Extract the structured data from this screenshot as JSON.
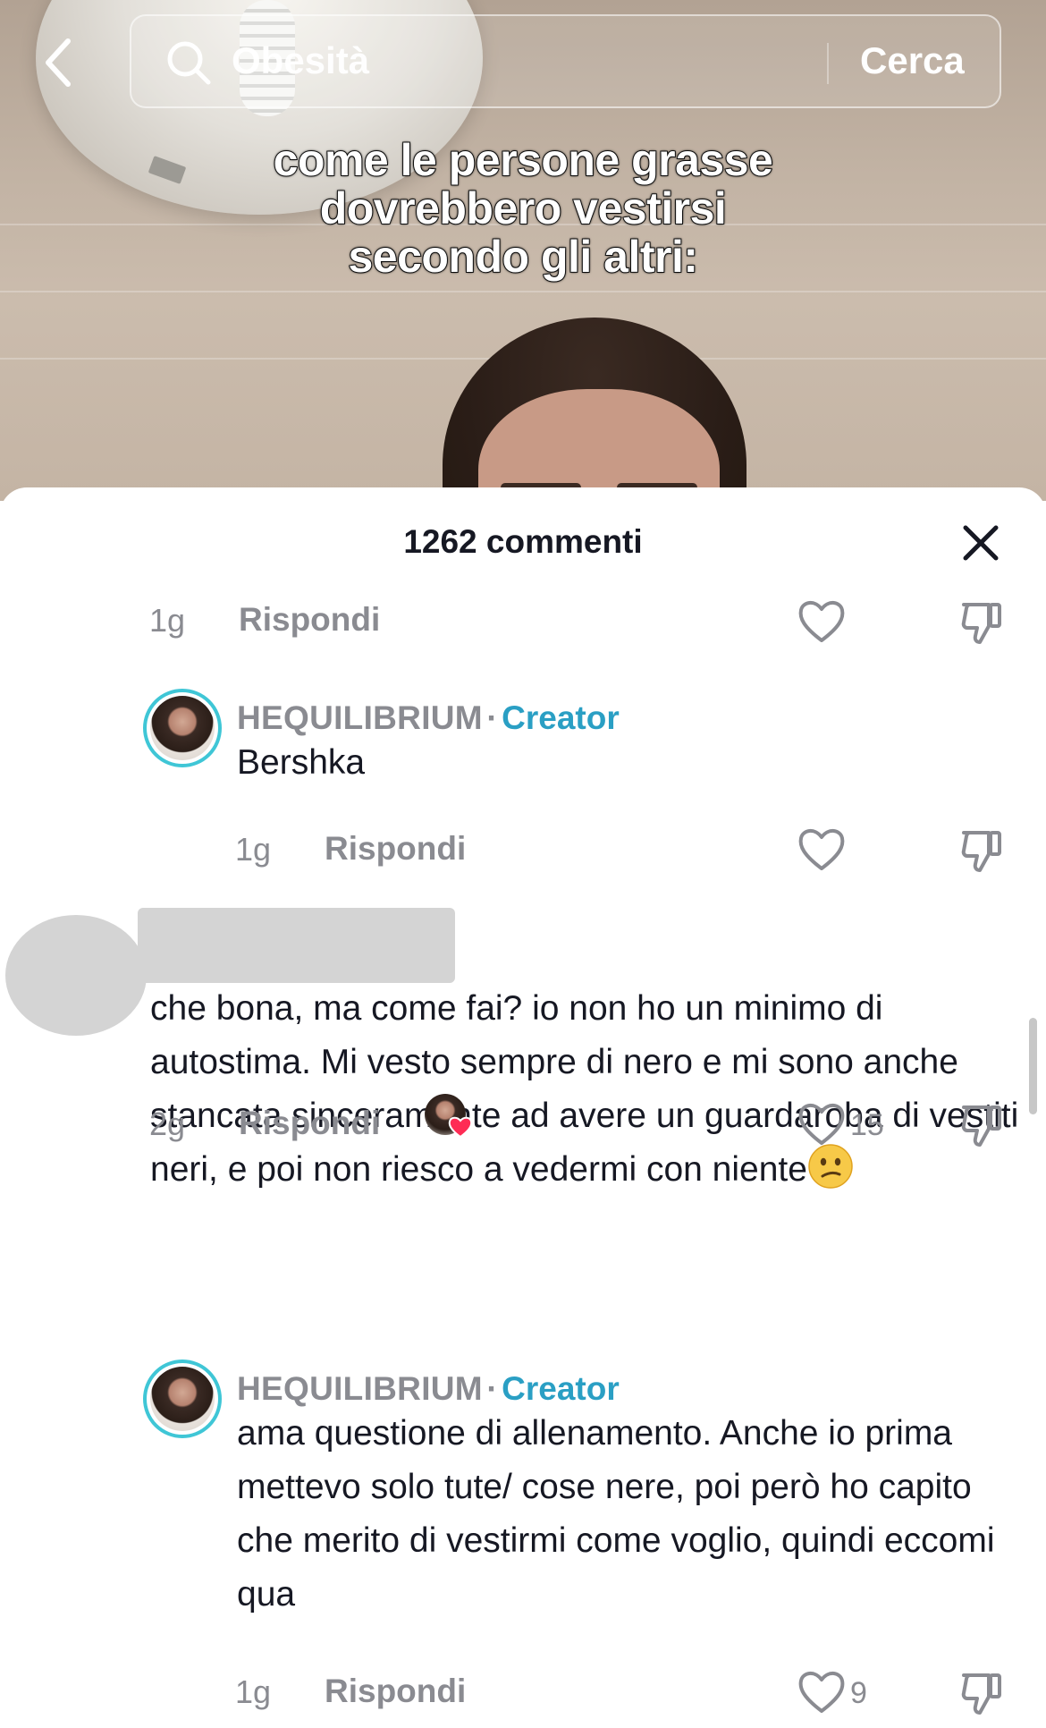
{
  "search": {
    "query": "Obesità",
    "button_label": "Cerca"
  },
  "video": {
    "caption_lines": [
      "come le persone  grasse",
      "dovrebbero vestirsi",
      "secondo gli altri:"
    ]
  },
  "comments_panel": {
    "title": "1262 commenti",
    "items": [
      {
        "time": "1g",
        "reply_label": "Rispondi"
      },
      {
        "username": "HEQUILIBRIUM",
        "separator": "·",
        "badge": "Creator",
        "text": "Bershka",
        "time": "1g",
        "reply_label": "Rispondi"
      },
      {
        "text": "che bona, ma come fai? io non ho un minimo di autostima. Mi vesto sempre di nero e mi sono anche stancata sinceramente ad avere un guardaroba di vestiti neri, e poi non riesco a vedermi con niente",
        "time": "2g",
        "reply_label": "Rispondi",
        "like_count": "15"
      },
      {
        "username": "HEQUILIBRIUM",
        "separator": "·",
        "badge": "Creator",
        "text": "ama questione di allenamento. Anche io prima mettevo solo tute/ cose nere, poi però ho capito che merito di vestirmi come voglio, quindi eccomi qua",
        "time": "1g",
        "reply_label": "Rispondi",
        "like_count": "9"
      }
    ]
  },
  "icons": {
    "back": "chevron-left-icon",
    "search": "search-icon",
    "close": "close-icon",
    "like": "heart-outline-icon",
    "dislike": "thumbs-down-icon",
    "emoji": "confused-face-emoji"
  },
  "colors": {
    "creator_badge": "#2a9fc4",
    "avatar_ring": "#3fc6d6",
    "muted_text": "#8a8b91",
    "like_badge": "#fe2c55"
  }
}
